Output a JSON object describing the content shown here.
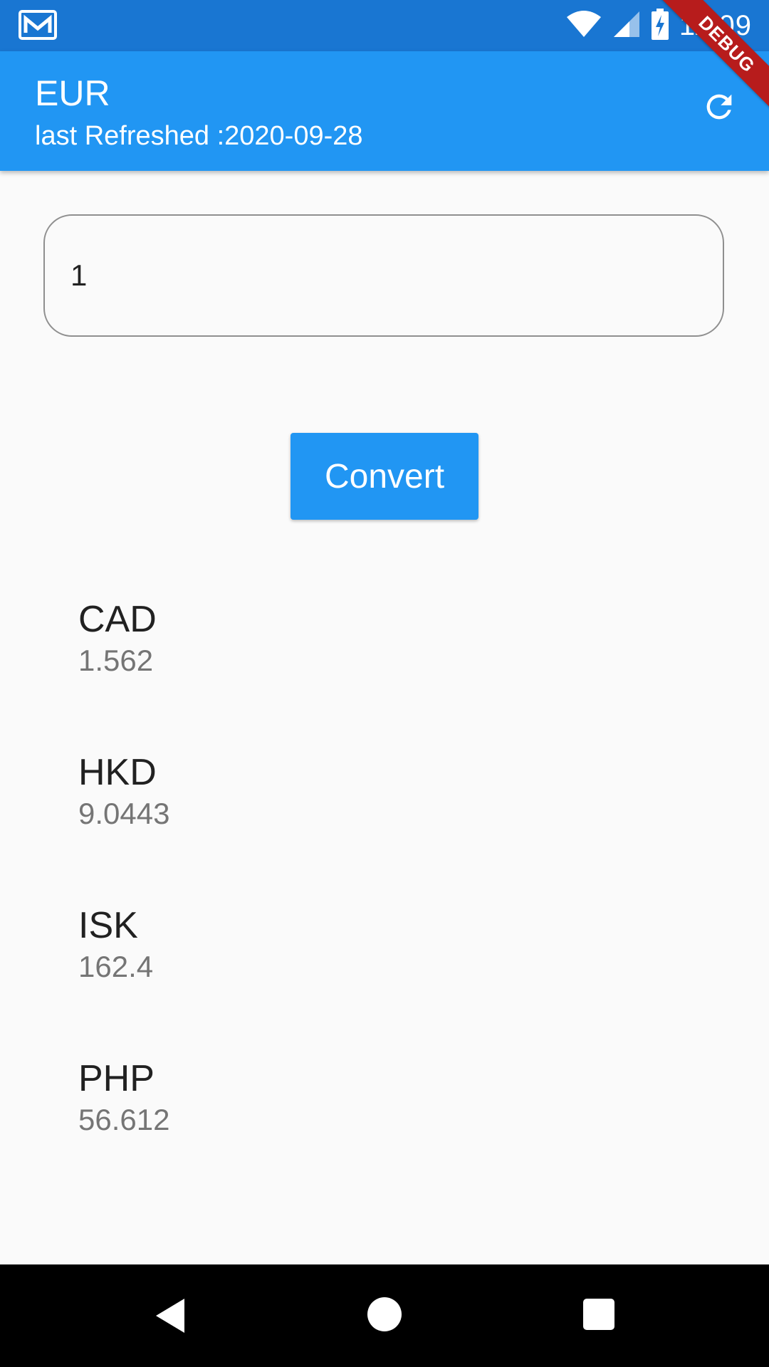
{
  "status_bar": {
    "time": "11:09",
    "icons": [
      "gmail-icon",
      "wifi-icon",
      "signal-icon",
      "battery-charging-icon"
    ]
  },
  "app_bar": {
    "title": "EUR",
    "subtitle": "last Refreshed :2020-09-28",
    "refresh_icon": "refresh-icon",
    "debug_banner": "DEBUG",
    "color": "#2196f3"
  },
  "amount_input": {
    "value": "1"
  },
  "convert_button": {
    "label": "Convert"
  },
  "rates": [
    {
      "code": "CAD",
      "value": "1.562"
    },
    {
      "code": "HKD",
      "value": "9.0443"
    },
    {
      "code": "ISK",
      "value": "162.4"
    },
    {
      "code": "PHP",
      "value": "56.612"
    }
  ],
  "nav_bar": {
    "icons": [
      "back-icon",
      "home-icon",
      "recent-apps-icon"
    ]
  }
}
